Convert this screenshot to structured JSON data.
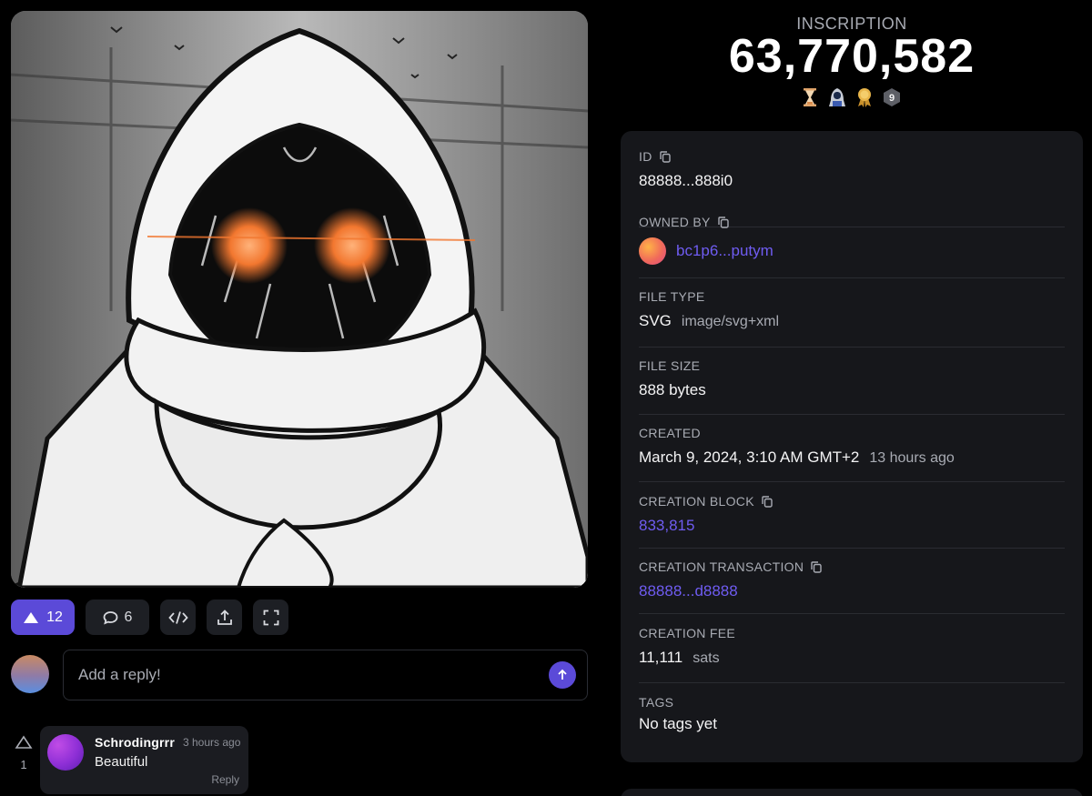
{
  "inscription": {
    "label": "INSCRIPTION",
    "number": "63,770,582",
    "badges": [
      "hourglass-icon",
      "hooded-figure-icon",
      "medal-icon",
      "number-badge-icon"
    ],
    "badge_number": "9"
  },
  "actions": {
    "likes": "12",
    "comments": "6",
    "accent": "#5b4ad8"
  },
  "reply": {
    "placeholder": "Add a reply!"
  },
  "comments": [
    {
      "user": "Schrodingrrr",
      "time": "3 hours ago",
      "text": "Beautiful",
      "reply_label": "Reply",
      "votes": "1"
    }
  ],
  "details": {
    "id": {
      "label": "ID",
      "value": "88888...888i0"
    },
    "owned_by": {
      "label": "OWNED BY",
      "value": "bc1p6...putym"
    },
    "file_type": {
      "label": "FILE TYPE",
      "value": "SVG",
      "sub": "image/svg+xml"
    },
    "file_size": {
      "label": "FILE SIZE",
      "value": "888 bytes"
    },
    "created": {
      "label": "CREATED",
      "value": "March 9, 2024, 3:10 AM GMT+2",
      "sub": "13 hours ago"
    },
    "creation_block": {
      "label": "CREATION BLOCK",
      "value": "833,815"
    },
    "creation_tx": {
      "label": "CREATION TRANSACTION",
      "value": "88888...d8888"
    },
    "creation_fee": {
      "label": "CREATION FEE",
      "value": "11,111",
      "sub": "sats"
    },
    "tags": {
      "label": "TAGS",
      "value": "No tags yet"
    }
  },
  "colors": {
    "background": "#000000",
    "card": "#16171b",
    "link": "#6f5cf2",
    "muted": "#a8abb3"
  }
}
